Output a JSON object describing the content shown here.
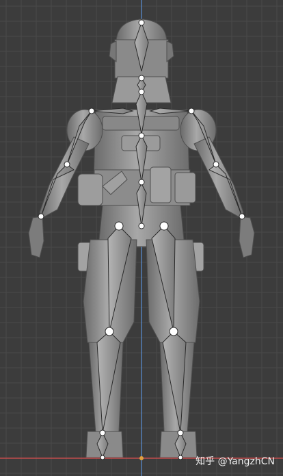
{
  "viewport": {
    "background": "#3c3c3c",
    "grid_color": "#4a4a4a",
    "axis_z_color": "#5b8fd6",
    "axis_x_color": "#c24d4d"
  },
  "model": {
    "body_color": "#8e8e8e",
    "body_highlight": "#a9a9a9",
    "body_shadow": "#5e5e5e",
    "bone_color": "#9a9a9a",
    "bone_outline": "#2a2a2a",
    "joint_color": "#ffffff"
  },
  "watermark": {
    "platform": "知乎",
    "handle": "@YangzhCN"
  }
}
